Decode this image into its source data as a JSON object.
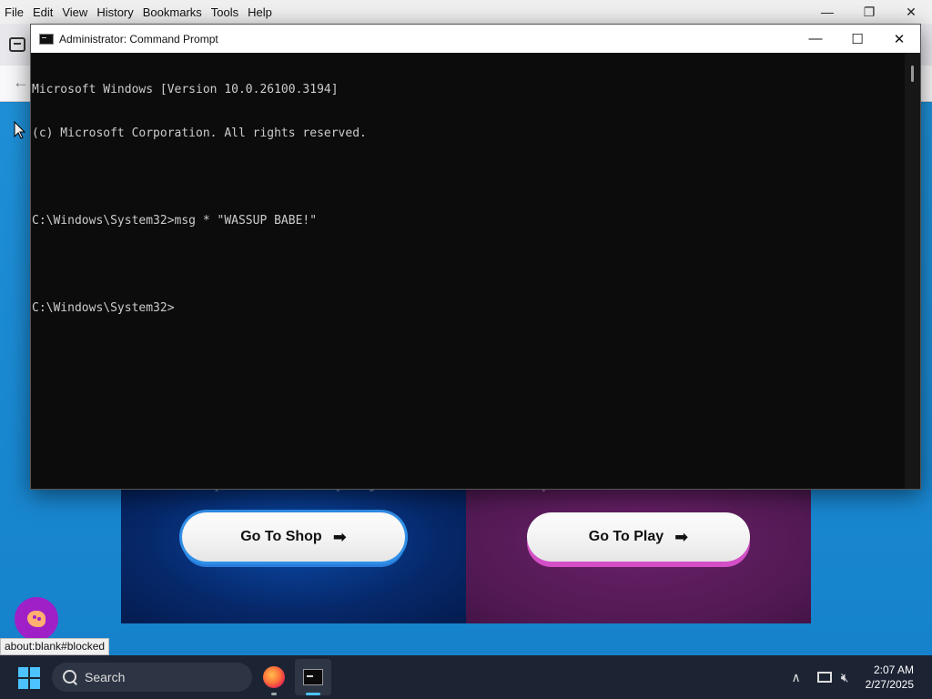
{
  "browser": {
    "menu": [
      {
        "label": "File",
        "u": "F"
      },
      {
        "label": "Edit",
        "u": "E"
      },
      {
        "label": "View",
        "u": "V"
      },
      {
        "label": "History",
        "u": "H"
      },
      {
        "label": "Bookmarks",
        "u": "B"
      },
      {
        "label": "Tools",
        "u": "T"
      },
      {
        "label": "Help",
        "u": "H"
      }
    ],
    "status_url": "about:blank#blocked"
  },
  "page": {
    "shop_card": {
      "subtitle": "Explore and Shop toys!",
      "button_label": "Go To Shop"
    },
    "play_card": {
      "subtitle": "Experience Fun & Activities",
      "button_label": "Go To Play"
    },
    "arrow_glyph": "➡"
  },
  "cmd": {
    "title": "Administrator: Command Prompt",
    "lines": [
      "Microsoft Windows [Version 10.0.26100.3194]",
      "(c) Microsoft Corporation. All rights reserved.",
      "",
      "C:\\Windows\\System32>msg * \"WASSUP BABE!\"",
      "",
      "C:\\Windows\\System32>"
    ]
  },
  "taskbar": {
    "search_placeholder": "Search",
    "time": "2:07 AM",
    "date": "2/27/2025"
  },
  "colors": {
    "page_bg": "#1a86d0",
    "shop_accent": "#2f8fe8",
    "play_accent": "#d44fc7",
    "taskbar_bg": "#1c2434"
  }
}
